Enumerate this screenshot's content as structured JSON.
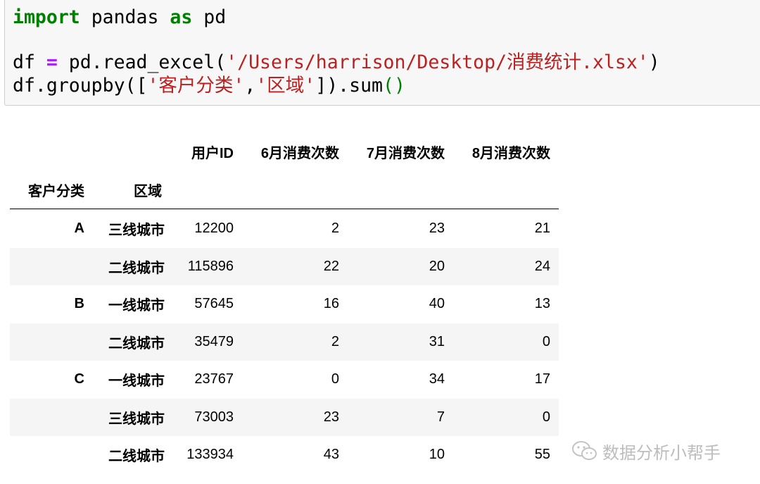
{
  "code": {
    "line1": {
      "kw1": "import",
      "mod": " pandas ",
      "kw2": "as",
      "alias": " pd"
    },
    "line2": {
      "var": "df ",
      "op": "=",
      "call": " pd.read_excel(",
      "str": "'/Users/harrison/Desktop/消费统计.xlsx'",
      "close": ")"
    },
    "line3": {
      "prefix": "df.groupby([",
      "s1": "'客户分类'",
      "comma": ",",
      "s2": "'区域'",
      "mid": "]).sum",
      "paren": "()"
    }
  },
  "table": {
    "columns": [
      "用户ID",
      "6月消费次数",
      "7月消费次数",
      "8月消费次数"
    ],
    "index_names": [
      "客户分类",
      "区域"
    ],
    "rows": [
      {
        "group": "A",
        "region": "三线城市",
        "uid": "12200",
        "m6": "2",
        "m7": "23",
        "m8": "21"
      },
      {
        "group": "",
        "region": "二线城市",
        "uid": "115896",
        "m6": "22",
        "m7": "20",
        "m8": "24"
      },
      {
        "group": "B",
        "region": "一线城市",
        "uid": "57645",
        "m6": "16",
        "m7": "40",
        "m8": "13"
      },
      {
        "group": "",
        "region": "二线城市",
        "uid": "35479",
        "m6": "2",
        "m7": "31",
        "m8": "0"
      },
      {
        "group": "C",
        "region": "一线城市",
        "uid": "23767",
        "m6": "0",
        "m7": "34",
        "m8": "17"
      },
      {
        "group": "",
        "region": "三线城市",
        "uid": "73003",
        "m6": "23",
        "m7": "7",
        "m8": "0"
      },
      {
        "group": "",
        "region": "二线城市",
        "uid": "133934",
        "m6": "43",
        "m7": "10",
        "m8": "55"
      }
    ]
  },
  "watermark": {
    "text": "数据分析小帮手",
    "icon": "wechat-icon"
  }
}
